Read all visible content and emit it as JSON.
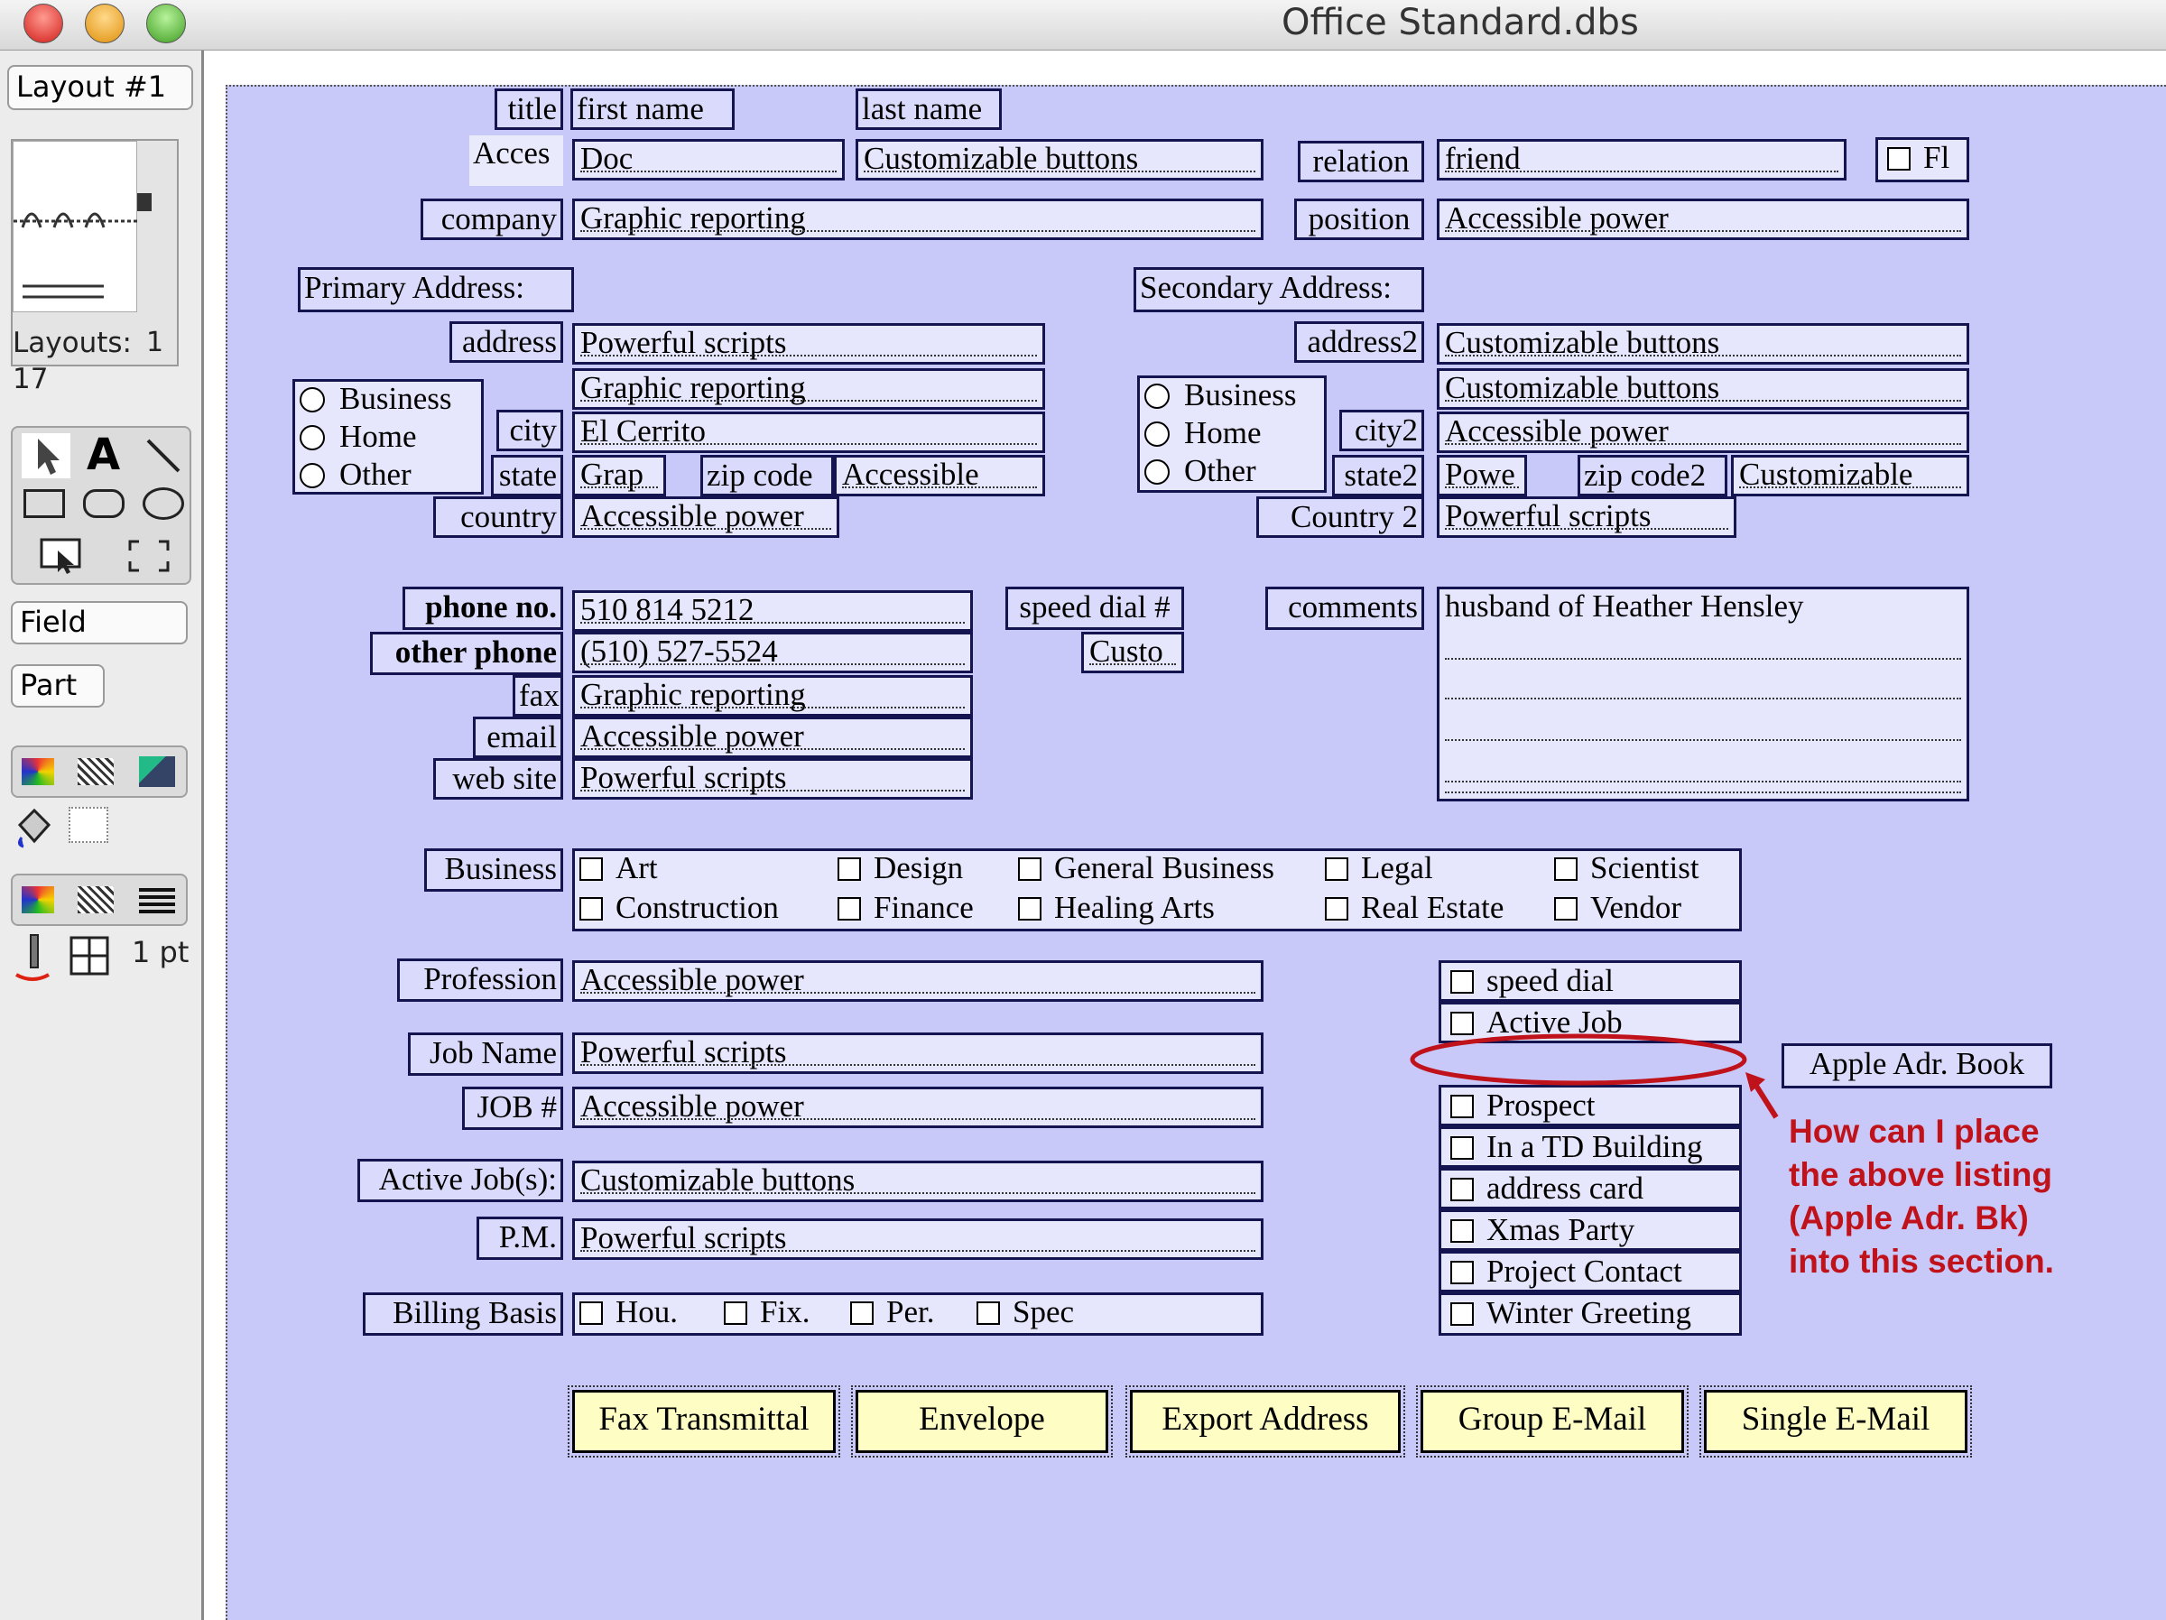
{
  "window": {
    "title": "Office Standard.dbs"
  },
  "toolpanel": {
    "layout_select": "Layout #1",
    "book_page": "1",
    "layouts_label": "Layouts:",
    "layouts_count": "17",
    "field_select": "Field",
    "part_select": "Part",
    "line_width": "1 pt"
  },
  "form": {
    "header_labels": {
      "title": "title",
      "first_name": "first name",
      "last_name": "last name",
      "acces": "Acces",
      "relation": "relation",
      "fl": "Fl",
      "company": "company",
      "position": "position"
    },
    "header_values": {
      "first_name": "Doc",
      "last_name": "Customizable buttons",
      "relation": "friend",
      "company": "Graphic reporting",
      "position": "Accessible power"
    },
    "primary": {
      "heading": "Primary Address:",
      "address_label": "address",
      "address1": "Powerful scripts",
      "address2": "Graphic reporting",
      "city_label": "city",
      "city": "El Cerrito",
      "state_label": "state",
      "state": "Grap",
      "zip_label": "zip code",
      "zip": "Accessible",
      "country_label": "country",
      "country": "Accessible power",
      "types": [
        "Business",
        "Home",
        "Other"
      ]
    },
    "secondary": {
      "heading": "Secondary Address:",
      "address_label": "address2",
      "address1": "Customizable buttons",
      "address2": "Customizable buttons",
      "city_label": "city2",
      "city": "Accessible power",
      "state_label": "state2",
      "state": "Powe",
      "zip_label": "zip code2",
      "zip": "Customizable",
      "country_label": "Country 2",
      "country": "Powerful scripts",
      "types": [
        "Business",
        "Home",
        "Other"
      ]
    },
    "contact": {
      "phone_label": "phone no.",
      "phone": "510  814  5212",
      "other_phone_label": "other phone",
      "other_phone": "(510) 527-5524",
      "fax_label": "fax",
      "fax": "Graphic reporting",
      "email_label": "email",
      "email": "Accessible power",
      "web_label": "web site",
      "web": "Powerful scripts",
      "speed_dial_label": "speed dial #",
      "speed_dial": "Custo",
      "comments_label": "comments",
      "comments": "husband of Heather Hensley"
    },
    "business": {
      "label": "Business",
      "options": [
        "Art",
        "Design",
        "General Business",
        "Legal",
        "Scientist",
        "Construction",
        "Finance",
        "Healing Arts",
        "Real Estate",
        "Vendor"
      ]
    },
    "jobs": {
      "profession_label": "Profession",
      "profession": "Accessible power",
      "job_name_label": "Job Name",
      "job_name": "Powerful scripts",
      "job_no_label": "JOB #",
      "job_no": "Accessible power",
      "active_jobs_label": "Active Job(s):",
      "active_jobs": "Customizable buttons",
      "pm_label": "P.M.",
      "pm": "Powerful scripts",
      "billing_label": "Billing Basis",
      "billing_options": [
        "Hou.",
        "Fix.",
        "Per.",
        "Spec"
      ]
    },
    "flags_top": [
      "speed dial",
      "Active Job"
    ],
    "flags_bottom": [
      "Prospect",
      "In a TD Building",
      "address card",
      "Xmas Party",
      "Project Contact",
      "Winter Greeting"
    ],
    "apple_label": "Apple Adr. Book",
    "annotation": [
      "How can I place",
      "the above listing",
      "(Apple Adr. Bk)",
      "into this section."
    ],
    "annotation_color": "#c0121a",
    "buttons": [
      "Fax Transmittal",
      "Envelope",
      "Export Address",
      "Group E-Mail",
      "Single E-Mail"
    ]
  }
}
